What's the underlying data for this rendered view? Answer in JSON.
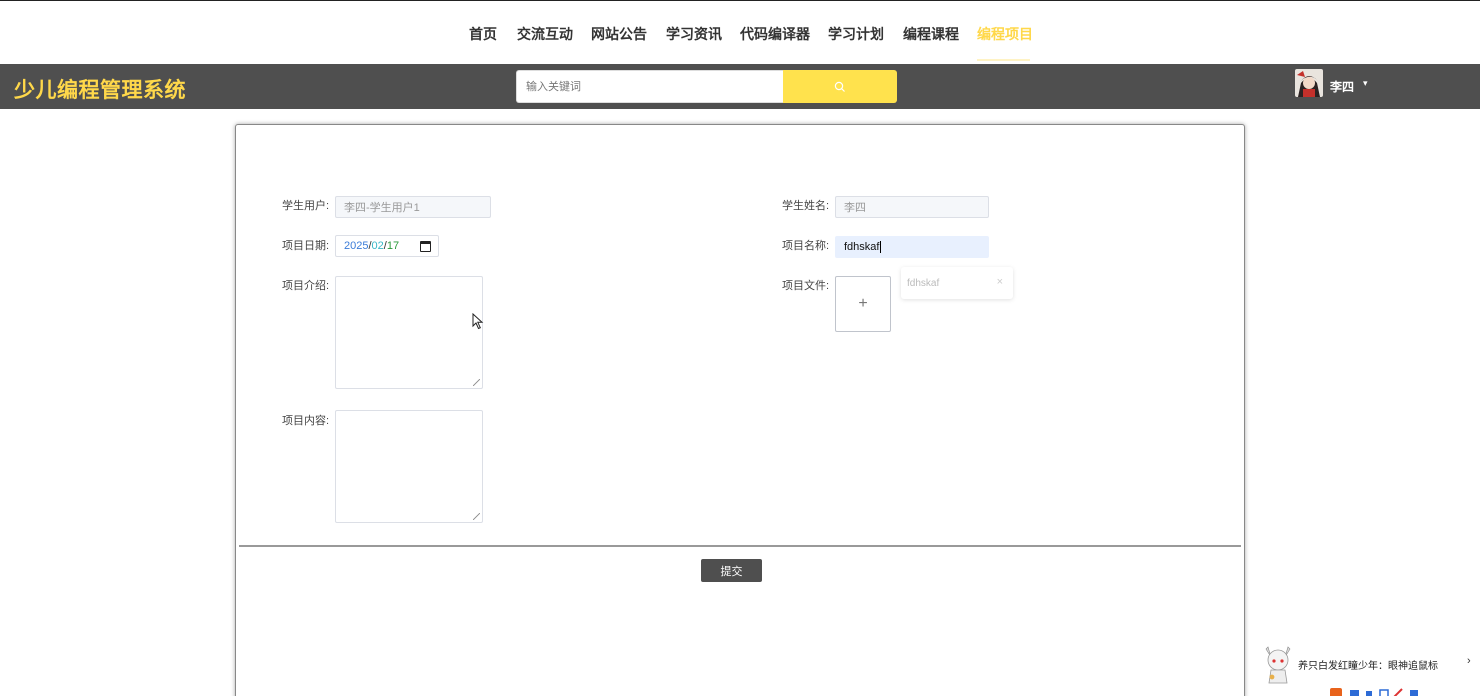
{
  "nav": {
    "items": [
      {
        "label": "首页",
        "active": false
      },
      {
        "label": "交流互动",
        "active": false
      },
      {
        "label": "网站公告",
        "active": false
      },
      {
        "label": "学习资讯",
        "active": false
      },
      {
        "label": "代码编译器",
        "active": false
      },
      {
        "label": "学习计划",
        "active": false
      },
      {
        "label": "编程课程",
        "active": false
      },
      {
        "label": "编程项目",
        "active": true
      }
    ]
  },
  "header": {
    "logo": "少儿编程管理系统",
    "search": {
      "placeholder": "输入关键词",
      "value": ""
    },
    "search_icon": "search-icon",
    "user": {
      "name": "李四",
      "caret": "▾"
    }
  },
  "form": {
    "student_user": {
      "label": "学生用户:",
      "value": "李四-学生用户1"
    },
    "student_name": {
      "label": "学生姓名:",
      "value": "李四"
    },
    "project_date": {
      "label": "项目日期:",
      "year": "2025",
      "month": "02",
      "day": "17",
      "sep": "/"
    },
    "project_name": {
      "label": "项目名称:",
      "value": "fdhskaf"
    },
    "project_intro": {
      "label": "项目介绍:",
      "value": ""
    },
    "project_file": {
      "label": "项目文件:",
      "upload_symbol": "+",
      "file_name": "fdhskaf",
      "remove_symbol": "×"
    },
    "project_content": {
      "label": "项目内容:",
      "value": ""
    },
    "submit_label": "提交"
  },
  "widget": {
    "text": "养只白发红瞳少年：眼神追鼠标",
    "arrow": "›"
  },
  "colors": {
    "accent": "#ffd84a",
    "header_bg": "#4f4f4f",
    "search_button": "#ffe24d"
  }
}
